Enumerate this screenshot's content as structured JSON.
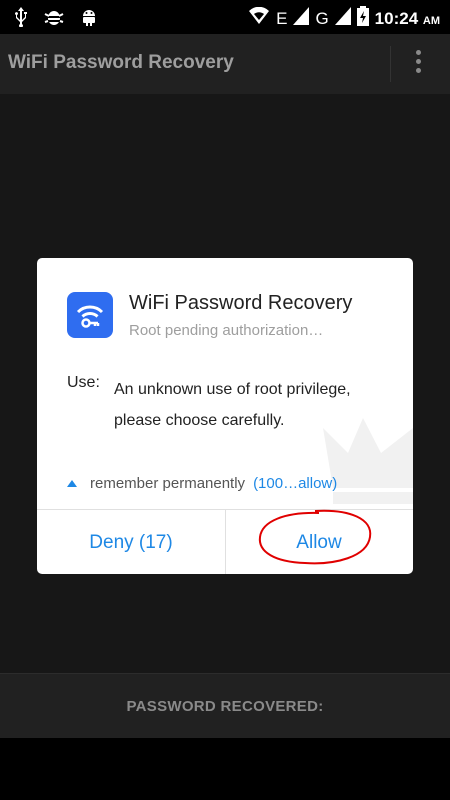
{
  "status_bar": {
    "network": "E",
    "network2": "G",
    "time": "10:24",
    "ampm": "AM"
  },
  "app_bar": {
    "title": "WiFi Password Recovery"
  },
  "dialog": {
    "app_name": "WiFi Password Recovery",
    "subtitle": "Root pending authorization…",
    "use_label": "Use:",
    "use_text": "An unknown use of root privilege, please choose carefully.",
    "remember_label": "remember permanently",
    "remember_option": "(100…allow)",
    "deny_label": "Deny (17)",
    "allow_label": "Allow"
  },
  "bottom": {
    "password_label": "PASSWORD RECOVERED:"
  },
  "colors": {
    "accent": "#1e88e5",
    "icon_bg": "#2f6df0",
    "annotation": "#e00000"
  }
}
